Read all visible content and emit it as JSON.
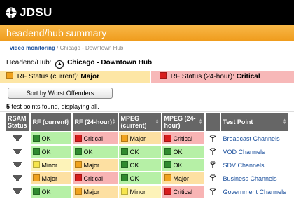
{
  "brand": {
    "name": "JDSU"
  },
  "page": {
    "title": "headend/hub summary"
  },
  "breadcrumb": {
    "link": "video monitoring",
    "sep": " / ",
    "path": "Chicago - Downtown Hub"
  },
  "hub": {
    "label": "Headend/Hub:",
    "name": "Chicago - Downtown Hub"
  },
  "status": {
    "current_label": "RF Status (current):",
    "current_value": "Major",
    "current_color": "#f0a21d",
    "h24_label": "RF Status (24-hour):",
    "h24_value": "Critical",
    "h24_color": "#d81c1c"
  },
  "sort_button": "Sort by Worst Offenders",
  "found": {
    "count": "5",
    "text": "test points found, displaying all."
  },
  "table": {
    "headers": [
      "RSAM Status",
      "RF (current)",
      "RF (24-hour)",
      "MPEG (current)",
      "MPEG (24-hour)",
      "",
      "Test Point"
    ],
    "rows": [
      {
        "rsam": "rsam-icon",
        "rf_cur": "OK",
        "rf_24": "Critical",
        "mpeg_cur": "Major",
        "mpeg_24": "Critical",
        "tp": "antenna-icon",
        "name": "Broadcast Channels"
      },
      {
        "rsam": "rsam-icon",
        "rf_cur": "OK",
        "rf_24": "OK",
        "mpeg_cur": "OK",
        "mpeg_24": "OK",
        "tp": "antenna-icon",
        "name": "VOD Channels"
      },
      {
        "rsam": "rsam-icon",
        "rf_cur": "Minor",
        "rf_24": "Major",
        "mpeg_cur": "OK",
        "mpeg_24": "OK",
        "tp": "antenna-icon",
        "name": "SDV Channels"
      },
      {
        "rsam": "rsam-icon",
        "rf_cur": "Major",
        "rf_24": "Critical",
        "mpeg_cur": "OK",
        "mpeg_24": "Major",
        "tp": "antenna-icon",
        "name": "Business Channels"
      },
      {
        "rsam": "rsam-icon",
        "rf_cur": "OK",
        "rf_24": "Major",
        "mpeg_cur": "Minor",
        "mpeg_24": "Critical",
        "tp": "antenna-icon",
        "name": "Government Channels"
      }
    ]
  },
  "colors": {
    "OK": "g",
    "Minor": "y",
    "Major": "o",
    "Critical": "r"
  }
}
